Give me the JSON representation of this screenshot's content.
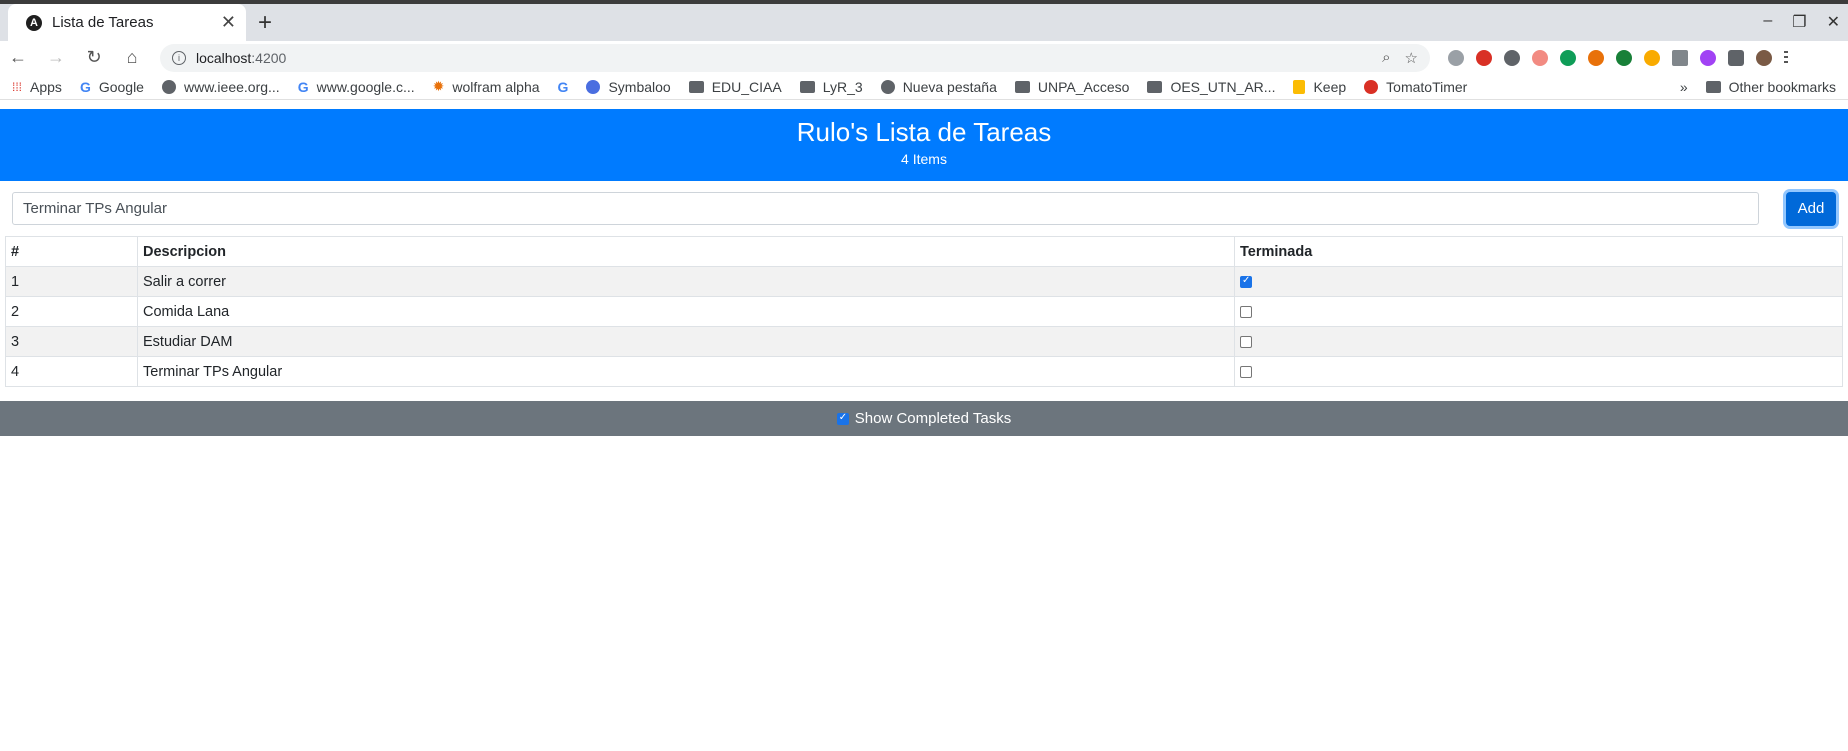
{
  "browser": {
    "tab_title": "Lista de Tareas",
    "tab_close": "✕",
    "new_tab": "+",
    "url_host": "localhost",
    "url_port": ":4200",
    "bookmarks": [
      {
        "label": "Apps",
        "icon": "apps-grid-icon"
      },
      {
        "label": "Google",
        "icon": "google-icon"
      },
      {
        "label": "www.ieee.org...",
        "icon": "globe-icon"
      },
      {
        "label": "www.google.c...",
        "icon": "google-icon"
      },
      {
        "label": "wolfram alpha",
        "icon": "wolfram-icon"
      },
      {
        "label": "",
        "icon": "google-icon"
      },
      {
        "label": "Symbaloo",
        "icon": "symbaloo-icon"
      },
      {
        "label": "EDU_CIAA",
        "icon": "folder-icon"
      },
      {
        "label": "LyR_3",
        "icon": "folder-icon"
      },
      {
        "label": "Nueva pestaña",
        "icon": "globe-icon"
      },
      {
        "label": "UNPA_Acceso",
        "icon": "folder-icon"
      },
      {
        "label": "OES_UTN_AR...",
        "icon": "folder-icon"
      },
      {
        "label": "Keep",
        "icon": "keep-icon"
      },
      {
        "label": "TomatoTimer",
        "icon": "tomato-icon"
      }
    ],
    "more_bookmarks": "»",
    "other_bookmarks": "Other bookmarks"
  },
  "app": {
    "title": "Rulo's Lista de Tareas",
    "count_text": "4 Items",
    "input_value": "Terminar TPs Angular",
    "add_label": "Add",
    "columns": [
      "#",
      "Descripcion",
      "Terminada"
    ],
    "rows": [
      {
        "num": "1",
        "desc": "Salir a correr",
        "done": true
      },
      {
        "num": "2",
        "desc": "Comida Lana",
        "done": false
      },
      {
        "num": "3",
        "desc": "Estudiar DAM",
        "done": false
      },
      {
        "num": "4",
        "desc": "Terminar TPs Angular",
        "done": false
      }
    ],
    "show_completed_label": "Show Completed Tasks",
    "show_completed": true
  },
  "colors": {
    "header_bg": "#007bff",
    "footer_bg": "#6c757d",
    "add_button_bg": "#0069d9"
  }
}
